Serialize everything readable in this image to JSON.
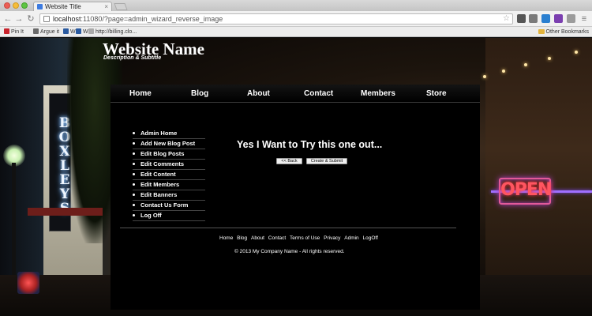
{
  "browser": {
    "tab_title": "Website Title",
    "url_host": "localhost",
    "url_path": ":11080/?page=admin_wizard_reverse_image",
    "bookmarks": [
      "Pin It",
      "Argue it",
      "W",
      "W",
      "http://billing.clo..."
    ],
    "other_bookmarks": "Other Bookmarks"
  },
  "site": {
    "name": "Website Name",
    "subtitle": "Description & Subtitle"
  },
  "nav": [
    "Home",
    "Blog",
    "About",
    "Contact",
    "Members",
    "Store"
  ],
  "admin_menu": [
    "Admin Home",
    "Add New Blog Post",
    "Edit Blog Posts",
    "Edit Comments",
    "Edit Content",
    "Edit Members",
    "Edit Banners",
    "Contact Us Form",
    "Log Off"
  ],
  "main": {
    "heading": "Yes I Want to Try this one out...",
    "back_button": "<< Back",
    "submit_button": "Create & Submit"
  },
  "footer": {
    "links": [
      "Home",
      "Blog",
      "About",
      "Contact",
      "Terms of Use",
      "Privacy",
      "Admin",
      "LogOff"
    ],
    "copyright": "© 2013 My Company Name - All rights reserved."
  },
  "decor": {
    "sign_text": "BOXLEYS",
    "open_sign": "OPEN"
  }
}
